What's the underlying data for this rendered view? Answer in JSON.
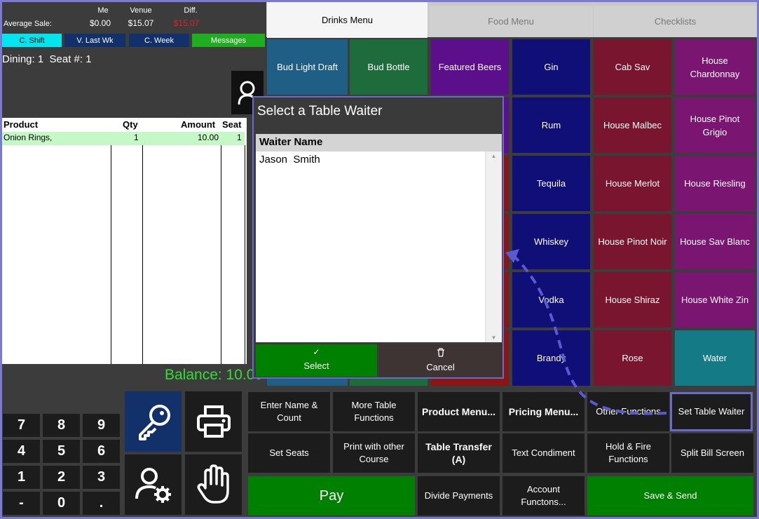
{
  "stats": {
    "headers": {
      "me": "Me",
      "venue": "Venue",
      "diff": "Diff."
    },
    "label": "Average Sale:",
    "me": "$0.00",
    "venue": "$15.07",
    "diff": "$15.07",
    "diff_color": "#e02020"
  },
  "period_buttons": [
    "C. Shift",
    "V. Last Wk",
    "C. Week"
  ],
  "messages_label": "Messages",
  "dining_info": "Dining: 1  Seat #: 1",
  "order": {
    "columns": [
      "Product",
      "Qty",
      "Amount",
      "Seat"
    ],
    "rows": [
      {
        "product": "Onion Rings,",
        "qty": "1",
        "amount": "10.00",
        "seat": "1"
      }
    ],
    "balance": "Balance: 10.00"
  },
  "tabs": [
    "Drinks Menu",
    "Food Menu",
    "Checklists"
  ],
  "menu": [
    [
      {
        "label": "Bud Light Draft",
        "color": "#1f5f86"
      },
      {
        "label": "Bud Bottle",
        "color": "#1e6b3c"
      },
      {
        "label": "Featured Beers",
        "color": "#5c0f8a"
      },
      {
        "label": "Gin",
        "color": "#100f78"
      },
      {
        "label": "Cab Sav",
        "color": "#7a1530"
      },
      {
        "label": "House Chardonnay",
        "color": "#7a1672"
      }
    ],
    [
      {
        "label": "",
        "color": "#1f5f86"
      },
      {
        "label": "",
        "color": "#1e6b3c"
      },
      {
        "label": "",
        "color": "#5c0f8a"
      },
      {
        "label": "Rum",
        "color": "#100f78"
      },
      {
        "label": "House Malbec",
        "color": "#7a1530"
      },
      {
        "label": "House Pinot Grigio",
        "color": "#7a1672"
      }
    ],
    [
      {
        "label": "",
        "color": "#1f5f86"
      },
      {
        "label": "",
        "color": "#1e6b3c"
      },
      {
        "label": "",
        "color": "#8a1515"
      },
      {
        "label": "Tequila",
        "color": "#100f78"
      },
      {
        "label": "House Merlot",
        "color": "#7a1530"
      },
      {
        "label": "House Riesling",
        "color": "#7a1672"
      }
    ],
    [
      {
        "label": "",
        "color": "#1f5f86"
      },
      {
        "label": "",
        "color": "#1e6b3c"
      },
      {
        "label": "",
        "color": "#8a1515"
      },
      {
        "label": "Whiskey",
        "color": "#100f78"
      },
      {
        "label": "House Pinot Noir",
        "color": "#7a1530"
      },
      {
        "label": "House Sav Blanc",
        "color": "#7a1672"
      }
    ],
    [
      {
        "label": "",
        "color": "#1f5f86"
      },
      {
        "label": "",
        "color": "#1e6b3c"
      },
      {
        "label": "",
        "color": "#8a1515"
      },
      {
        "label": "Vodka",
        "color": "#100f78"
      },
      {
        "label": "House Shiraz",
        "color": "#7a1530"
      },
      {
        "label": "House White Zin",
        "color": "#7a1672"
      }
    ],
    [
      {
        "label": "",
        "color": "#1f5f86"
      },
      {
        "label": "",
        "color": "#1e6b3c"
      },
      {
        "label": "",
        "color": "#8a1515"
      },
      {
        "label": "Brandy",
        "color": "#100f78"
      },
      {
        "label": "Rose",
        "color": "#7a1530"
      },
      {
        "label": "Water",
        "color": "#137a86"
      }
    ]
  ],
  "functions": {
    "enter_name": "Enter Name & Count",
    "more_table": "More Table Functions",
    "product_menu": "Product Menu...",
    "pricing_menu": "Pricing Menu...",
    "other_functions": "Other Functions",
    "set_table_waiter": "Set Table Waiter",
    "set_seats": "Set Seats",
    "print_other_course": "Print with other Course",
    "table_transfer": "Table Transfer (A)",
    "text_condiment": "Text Condiment",
    "hold_fire": "Hold & Fire Functions",
    "split_bill": "Split Bill Screen",
    "pay": "Pay",
    "divide_payments": "Divide Payments",
    "account_functions": "Account Functons...",
    "save_send": "Save & Send"
  },
  "keypad": [
    "7",
    "8",
    "9",
    "4",
    "5",
    "6",
    "1",
    "2",
    "3",
    "-",
    "0",
    "."
  ],
  "icons": {
    "key": "key-icon",
    "print": "printer-icon",
    "user_settings": "user-settings-icon",
    "hand": "hand-icon",
    "user": "user-icon"
  },
  "dialog": {
    "title": "Select a Table Waiter",
    "column": "Waiter Name",
    "waiters": [
      "Jason  Smith"
    ],
    "select": "Select",
    "cancel": "Cancel"
  },
  "colors": {
    "accent": "#6a6ac8",
    "green_button": "#008000",
    "balance": "#33dd33"
  }
}
